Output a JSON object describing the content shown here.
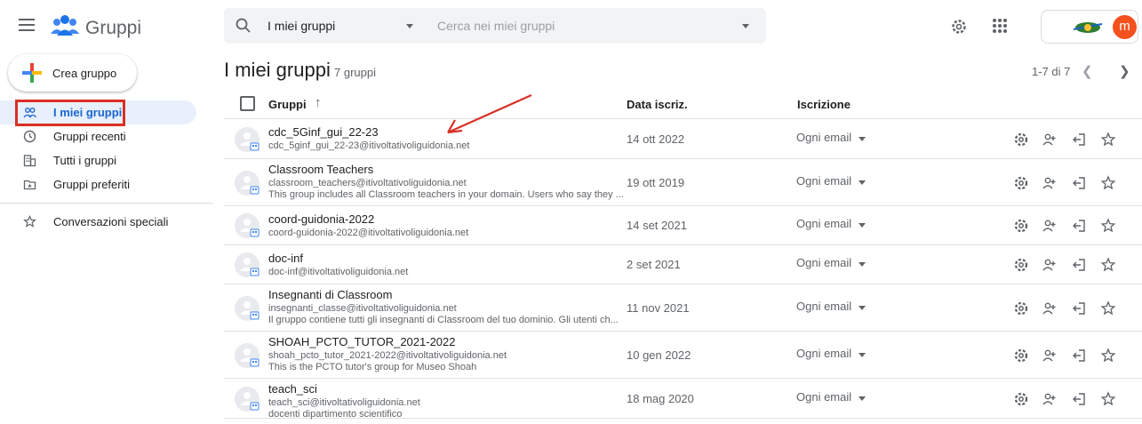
{
  "app": {
    "title": "Gruppi"
  },
  "search": {
    "scope": "I miei gruppi",
    "placeholder": "Cerca nei miei gruppi"
  },
  "account": {
    "initial": "m"
  },
  "sidebar": {
    "create_label": "Crea gruppo",
    "items": [
      {
        "label": "I miei gruppi",
        "icon": "groups-icon",
        "active": true
      },
      {
        "label": "Gruppi recenti",
        "icon": "clock-icon"
      },
      {
        "label": "Tutti i gruppi",
        "icon": "building-icon"
      },
      {
        "label": "Gruppi preferiti",
        "icon": "folder-star-icon"
      }
    ],
    "special": {
      "label": "Conversazioni speciali",
      "icon": "star-icon"
    }
  },
  "main": {
    "title": "I miei gruppi",
    "count": "7 gruppi",
    "pagination": "1-7 di 7",
    "headers": {
      "groups": "Gruppi",
      "date": "Data iscriz.",
      "subscription": "Iscrizione"
    },
    "rows": [
      {
        "name": "cdc_5Ginf_gui_22-23",
        "email": "cdc_5ginf_gui_22-23@itivoltativoliguidonia.net",
        "desc": "",
        "date": "14 ott 2022",
        "sub": "Ogni email"
      },
      {
        "name": "Classroom Teachers",
        "email": "classroom_teachers@itivoltativoliguidonia.net",
        "desc": "This group includes all Classroom teachers in your domain. Users who say they ...",
        "date": "19 ott 2019",
        "sub": "Ogni email"
      },
      {
        "name": "coord-guidonia-2022",
        "email": "coord-guidonia-2022@itivoltativoliguidonia.net",
        "desc": "",
        "date": "14 set 2021",
        "sub": "Ogni email"
      },
      {
        "name": "doc-inf",
        "email": "doc-inf@itivoltativoliguidonia.net",
        "desc": "",
        "date": "2 set 2021",
        "sub": "Ogni email"
      },
      {
        "name": "Insegnanti di Classroom",
        "email": "insegnanti_classe@itivoltativoliguidonia.net",
        "desc": "Il gruppo contiene tutti gli insegnanti di Classroom del tuo dominio. Gli utenti ch...",
        "date": "11 nov 2021",
        "sub": "Ogni email"
      },
      {
        "name": "SHOAH_PCTO_TUTOR_2021-2022",
        "email": "shoah_pcto_tutor_2021-2022@itivoltativoliguidonia.net",
        "desc": "This is the PCTO tutor's group for Museo Shoah",
        "date": "10 gen 2022",
        "sub": "Ogni email"
      },
      {
        "name": "teach_sci",
        "email": "teach_sci@itivoltativoliguidonia.net",
        "desc": "docenti dipartimento scientifico",
        "date": "18 mag 2020",
        "sub": "Ogni email"
      }
    ]
  },
  "colors": {
    "accent": "#1967d2",
    "highlight": "#d93025",
    "active_bg": "#e8f0fe"
  }
}
